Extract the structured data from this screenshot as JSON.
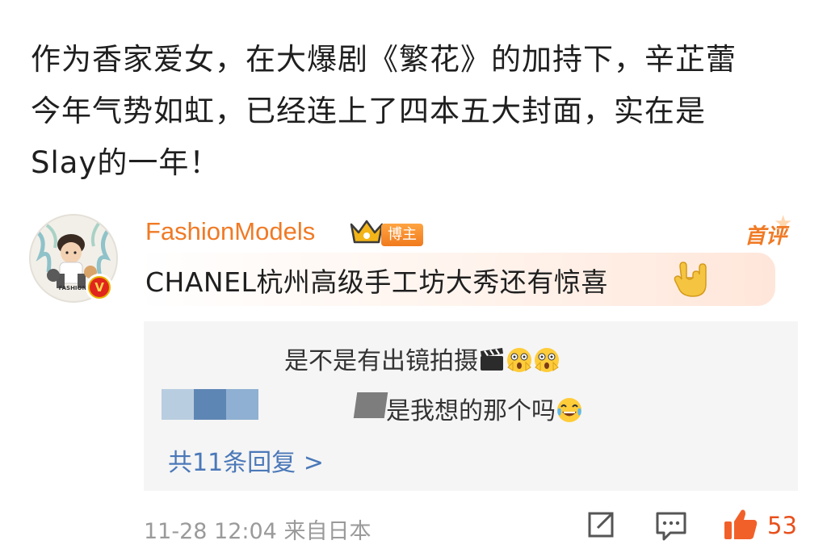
{
  "post": {
    "lines": [
      "作为香家爱女，在大爆剧《繁花》的加持下，辛芷蕾",
      "今年气势如虹，已经连上了四本五大封面，实在是",
      "Slay的一年！"
    ]
  },
  "comment": {
    "username": "FashionModels",
    "role_tag": "博主",
    "first_comment_label": "首评",
    "text": "CHANEL杭州高级手工坊大秀还有惊喜",
    "avatar_text": "FASHION",
    "verified_mark": "V"
  },
  "replies": {
    "items": [
      {
        "text": "是不是有出镜拍摄",
        "icons": [
          "clapperboard-icon",
          "astonished-emoji",
          "astonished-emoji"
        ]
      },
      {
        "text": "是我想的那个吗",
        "icons": [
          "tears-of-joy-emoji"
        ]
      }
    ],
    "more_label": "共11条回复 >"
  },
  "footer": {
    "timestamp": "11-28 12:04",
    "source": "来自日本",
    "like_count": "53"
  },
  "colors": {
    "username": "#f07a25",
    "link": "#4a78b8",
    "like": "#e8501c",
    "meta": "#9a9a9a"
  }
}
